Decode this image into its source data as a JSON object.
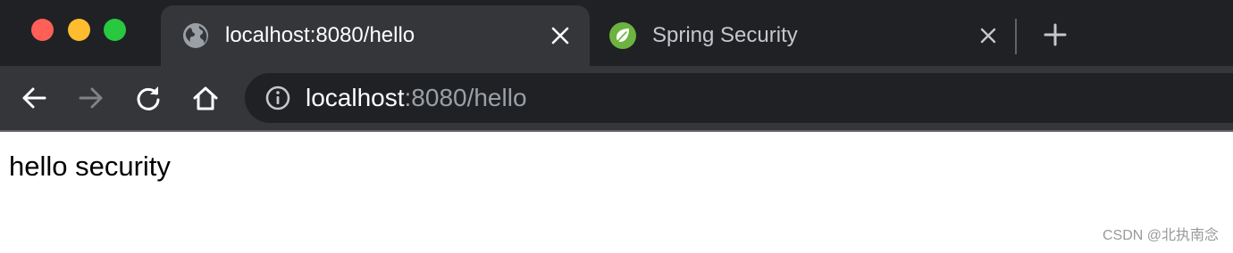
{
  "window": {
    "controls": [
      "close",
      "minimize",
      "maximize"
    ]
  },
  "tabs": [
    {
      "title": "localhost:8080/hello",
      "favicon": "globe-icon",
      "active": true
    },
    {
      "title": "Spring Security",
      "favicon": "spring-leaf-icon",
      "active": false
    }
  ],
  "toolbar": {
    "buttons": [
      "back-icon",
      "forward-icon",
      "reload-icon",
      "home-icon"
    ],
    "forward_enabled": false
  },
  "address_bar": {
    "security_icon": "info-icon",
    "host": "localhost",
    "rest": ":8080/hello"
  },
  "page": {
    "body_text": "hello security"
  },
  "watermark": {
    "text": "CSDN @北执南念"
  },
  "colors": {
    "tabstrip": "#202124",
    "toolbar": "#35363a",
    "omnibox": "#202124",
    "spring_green": "#6db33f"
  }
}
